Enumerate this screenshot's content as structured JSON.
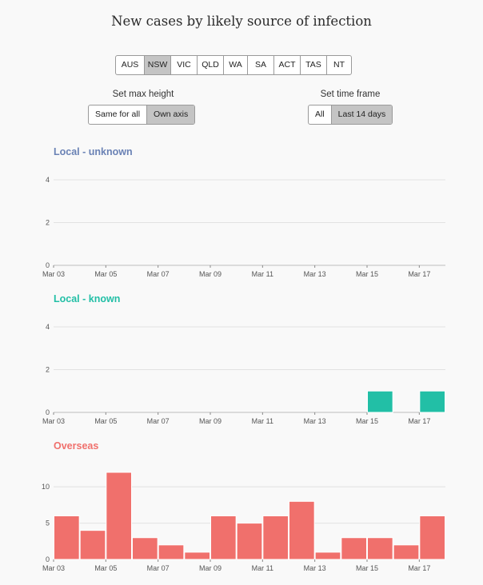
{
  "title": "New cases by likely source of infection",
  "regions": [
    {
      "label": "AUS",
      "active": false
    },
    {
      "label": "NSW",
      "active": true
    },
    {
      "label": "VIC",
      "active": false
    },
    {
      "label": "QLD",
      "active": false
    },
    {
      "label": "WA",
      "active": false
    },
    {
      "label": "SA",
      "active": false
    },
    {
      "label": "ACT",
      "active": false
    },
    {
      "label": "TAS",
      "active": false
    },
    {
      "label": "NT",
      "active": false
    }
  ],
  "max_height": {
    "label": "Set max height",
    "options": [
      {
        "label": "Same for all",
        "active": false
      },
      {
        "label": "Own axis",
        "active": true
      }
    ]
  },
  "time_frame": {
    "label": "Set time frame",
    "options": [
      {
        "label": "All",
        "active": false
      },
      {
        "label": "Last 14 days",
        "active": true
      }
    ]
  },
  "chart_data": [
    {
      "type": "bar",
      "title": "Local - unknown",
      "color": "#6a82b5",
      "x": [
        "Mar 03",
        "Mar 04",
        "Mar 05",
        "Mar 06",
        "Mar 07",
        "Mar 08",
        "Mar 09",
        "Mar 10",
        "Mar 11",
        "Mar 12",
        "Mar 13",
        "Mar 14",
        "Mar 15",
        "Mar 16",
        "Mar 17"
      ],
      "xtick_labels": [
        "Mar 03",
        "Mar 05",
        "Mar 07",
        "Mar 09",
        "Mar 11",
        "Mar 13",
        "Mar 15",
        "Mar 17"
      ],
      "values": [
        0,
        0,
        0,
        0,
        0,
        0,
        0,
        0,
        0,
        0,
        0,
        0,
        0,
        0,
        0
      ],
      "ylim": [
        0,
        4
      ],
      "yticks": [
        0,
        2,
        4
      ],
      "grid": true
    },
    {
      "type": "bar",
      "title": "Local - known",
      "color": "#22bfa6",
      "x": [
        "Mar 03",
        "Mar 04",
        "Mar 05",
        "Mar 06",
        "Mar 07",
        "Mar 08",
        "Mar 09",
        "Mar 10",
        "Mar 11",
        "Mar 12",
        "Mar 13",
        "Mar 14",
        "Mar 15",
        "Mar 16",
        "Mar 17"
      ],
      "xtick_labels": [
        "Mar 03",
        "Mar 05",
        "Mar 07",
        "Mar 09",
        "Mar 11",
        "Mar 13",
        "Mar 15",
        "Mar 17"
      ],
      "values": [
        0,
        0,
        0,
        0,
        0,
        0,
        0,
        0,
        0,
        0,
        0,
        0,
        1,
        0,
        1
      ],
      "ylim": [
        0,
        4
      ],
      "yticks": [
        0,
        2,
        4
      ],
      "grid": true
    },
    {
      "type": "bar",
      "title": "Overseas",
      "color": "#f0706c",
      "x": [
        "Mar 03",
        "Mar 04",
        "Mar 05",
        "Mar 06",
        "Mar 07",
        "Mar 08",
        "Mar 09",
        "Mar 10",
        "Mar 11",
        "Mar 12",
        "Mar 13",
        "Mar 14",
        "Mar 15",
        "Mar 16",
        "Mar 17"
      ],
      "xtick_labels": [
        "Mar 03",
        "Mar 05",
        "Mar 07",
        "Mar 09",
        "Mar 11",
        "Mar 13",
        "Mar 15",
        "Mar 17"
      ],
      "values": [
        6,
        4,
        12,
        3,
        2,
        1,
        6,
        5,
        6,
        8,
        1,
        3,
        3,
        2,
        6
      ],
      "ylim": [
        0,
        12
      ],
      "yticks": [
        0,
        5,
        10
      ],
      "grid": true
    }
  ]
}
